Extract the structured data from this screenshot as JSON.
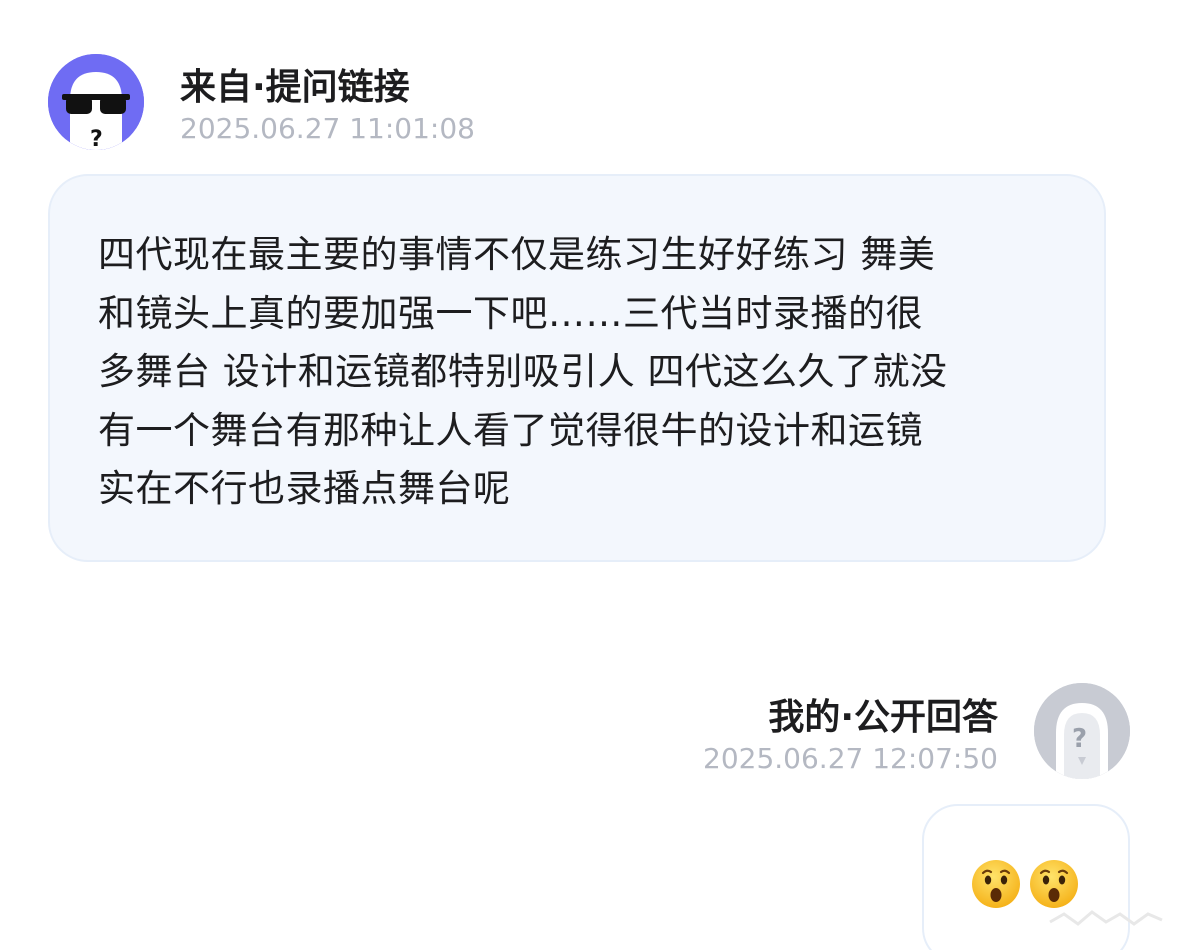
{
  "question": {
    "title": "来自·提问链接",
    "timestamp": "2025.06.27 11:01:08",
    "lines": [
      "四代现在最主要的事情不仅是练习生好好练习 舞美",
      "和镜头上真的要加强一下吧……三代当时录播的很",
      "多舞台 设计和运镜都特别吸引人 四代这么久了就没",
      "有一个舞台有那种让人看了觉得很牛的设计和运镜",
      "实在不行也录播点舞台呢"
    ]
  },
  "answer": {
    "title": "我的·公开回答",
    "timestamp": "2025.06.27 12:07:50",
    "emojis": [
      "hushed-face-emoji",
      "hushed-face-emoji"
    ]
  },
  "colors": {
    "question_avatar_bg": "#6f6cf3",
    "answer_avatar_bg": "#c8cbd3",
    "bubble_bg": "#f3f7fd",
    "timestamp": "#b4b8c2",
    "text": "#1d1d1f"
  }
}
